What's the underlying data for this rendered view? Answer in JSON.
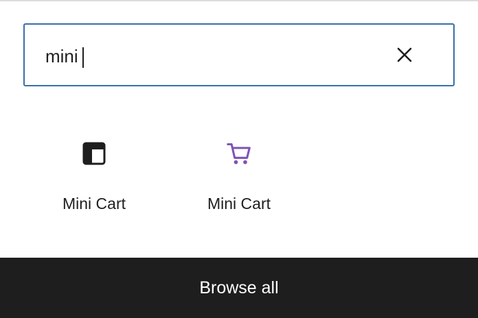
{
  "search": {
    "value": "mini",
    "clear_icon": "close-icon"
  },
  "results": [
    {
      "label": "Mini Cart",
      "icon": "layout-template-icon",
      "icon_color": "#1e1e1e"
    },
    {
      "label": "Mini Cart",
      "icon": "shopping-cart-icon",
      "icon_color": "#7f54b3"
    }
  ],
  "footer": {
    "browse_all_label": "Browse all",
    "background": "#1e1e1e"
  },
  "colors": {
    "focus_border": "#3a6fa5",
    "text": "#1e1e1e"
  }
}
